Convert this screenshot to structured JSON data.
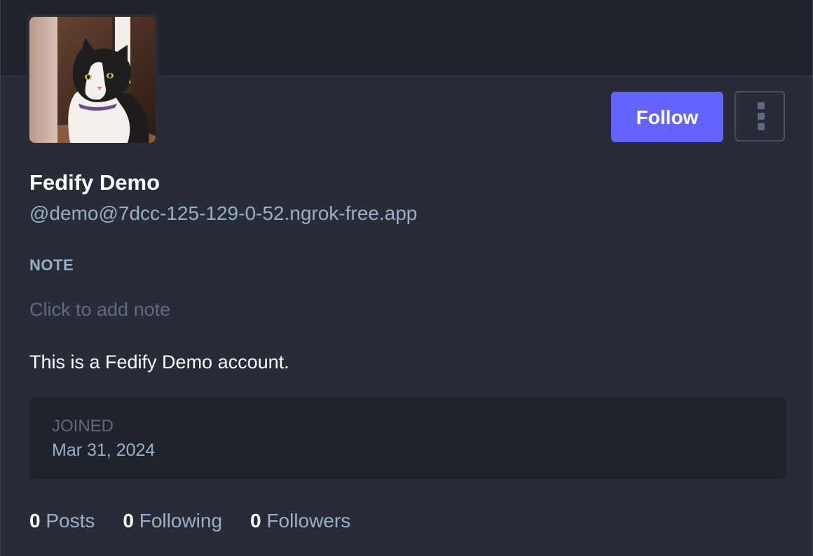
{
  "profile": {
    "display_name": "Fedify Demo",
    "acct": "@demo@7dcc-125-129-0-52.ngrok-free.app",
    "avatar_icon": "cat-photo-avatar",
    "bio": "This is a Fedify Demo account."
  },
  "actions": {
    "follow_label": "Follow",
    "menu_icon": "vertical-ellipsis-icon"
  },
  "note": {
    "label": "NOTE",
    "placeholder": "Click to add note"
  },
  "fields": [
    {
      "name": "JOINED",
      "value": "Mar 31, 2024"
    }
  ],
  "counters": {
    "posts": {
      "count": "0",
      "label": "Posts"
    },
    "following": {
      "count": "0",
      "label": "Following"
    },
    "followers": {
      "count": "0",
      "label": "Followers"
    }
  },
  "colors": {
    "accent": "#6364ff",
    "background": "#282c37",
    "banner": "#1f232b",
    "secondary_text": "#9baec8",
    "muted_text": "#606984"
  }
}
